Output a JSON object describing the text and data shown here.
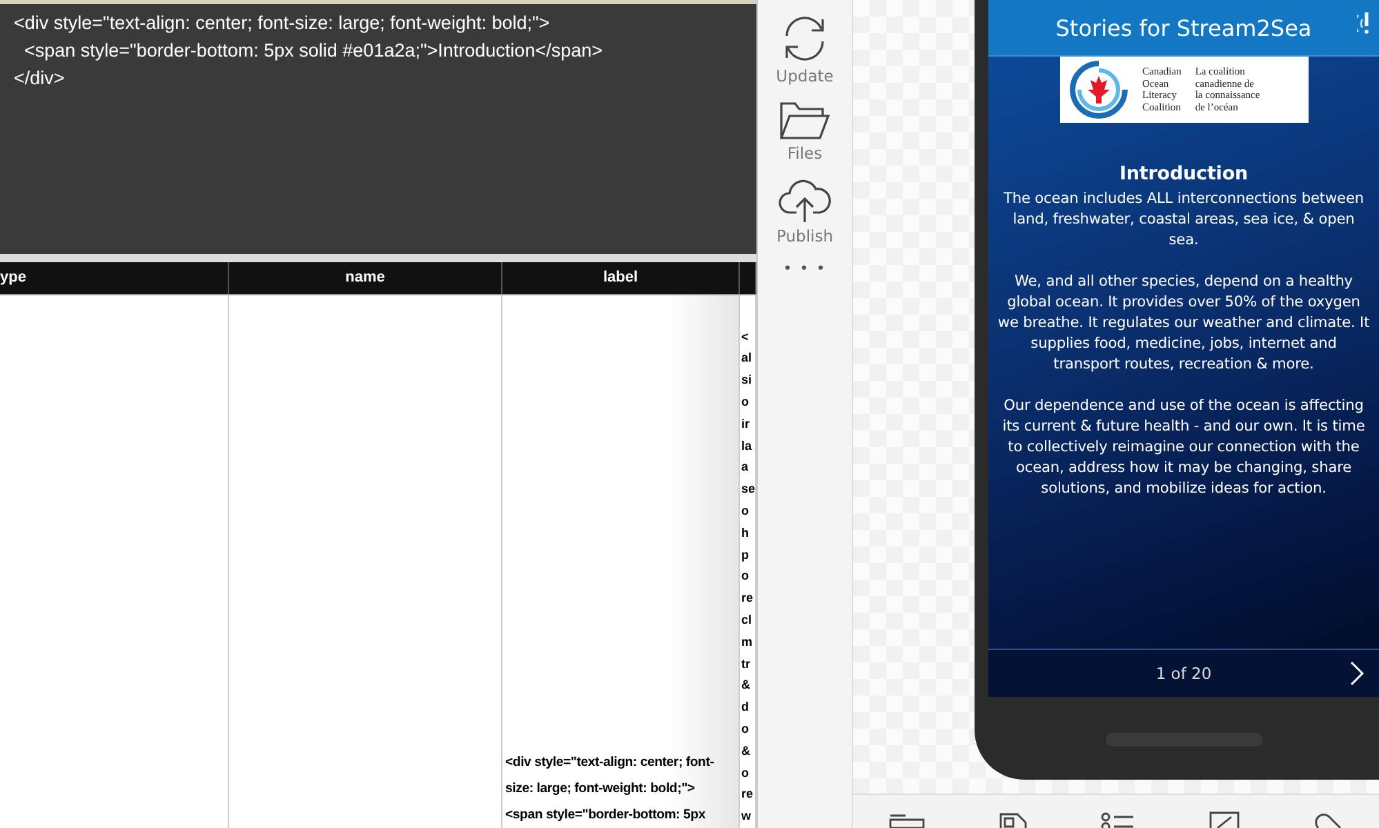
{
  "editor": {
    "lines": [
      "<div style=\"text-align: center; font-size: large; font-weight: bold;\">",
      "  <span style=\"border-bottom: 5px solid #e01a2a;\">Introduction</span>",
      "</div>"
    ]
  },
  "table": {
    "columns": [
      "ype",
      "name",
      "label"
    ],
    "cells": {
      "label": [
        "<div style=\"text-align: center; font-",
        "size: large; font-weight: bold;\">",
        "  <span style=\"border-bottom: 5px"
      ],
      "column_4": [
        "<",
        "al",
        "si",
        "o",
        "ir",
        "la",
        "a",
        "se",
        "o",
        "h",
        "p",
        "o",
        "re",
        "cl",
        "m",
        "tr",
        "&",
        "d",
        "o",
        "&",
        "o",
        "re",
        "w"
      ]
    }
  },
  "toolbar": {
    "items": [
      {
        "kind": "update",
        "label": "Update"
      },
      {
        "kind": "files",
        "label": "Files"
      },
      {
        "kind": "publish",
        "label": "Publish"
      },
      {
        "kind": "more",
        "label": "• • •"
      }
    ]
  },
  "preview": {
    "title": "Stories for Stream2Sea",
    "logo": {
      "english": [
        "Canadian",
        "Ocean",
        "Literacy",
        "Coalition"
      ],
      "french": [
        "La coalition",
        "canadienne de",
        "la connaissance",
        "de l’océan"
      ]
    },
    "heading": "Introduction",
    "paragraphs": [
      "The ocean includes ALL interconnections between land, freshwater, coastal areas, sea ice, & open sea.",
      "We, and all other species, depend on a healthy global ocean. It provides over 50% of the oxygen we breathe. It regulates our weather and climate. It supplies food, medicine, jobs, internet and transport routes, recreation & more.",
      "Our dependence and use of the ocean is affecting its current & future health - and our own. It is time to collectively reimagine our connection with the ocean, address how it may be changing, share solutions, and mobilize ideas for action."
    ],
    "pager": "1 of 20"
  }
}
